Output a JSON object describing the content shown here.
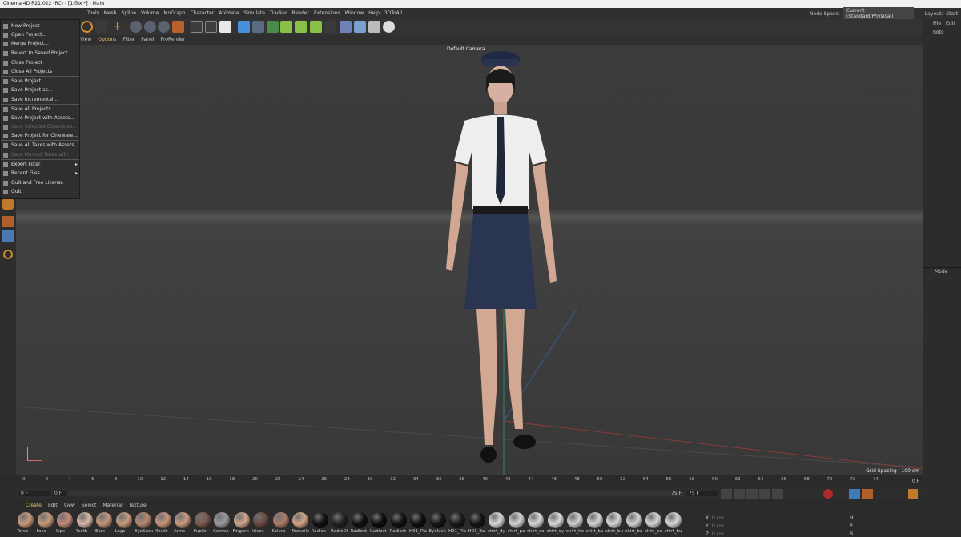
{
  "window": {
    "title": "Cinema 4D R21.022 (RC) - [1.fbx *] - Main"
  },
  "menubar": {
    "items": [
      "Tools",
      "Mesh",
      "Spline",
      "Volume",
      "MoGraph",
      "Character",
      "Animate",
      "Simulate",
      "Tracker",
      "Render",
      "Extensions",
      "Window",
      "Help",
      "3DToAll"
    ],
    "node_space_label": "Node Space:",
    "node_space_value": "Current (Standard/Physical)",
    "layout_label": "Layout:",
    "layout_value": "Start"
  },
  "right_tabs": {
    "file": "File",
    "edit": "Edit",
    "object": "Roto",
    "mode": "Mode"
  },
  "viewport_menu": [
    "View",
    "Options",
    "Filter",
    "Panel",
    "ProRender"
  ],
  "viewport": {
    "camera_label": "Default Camera",
    "grid_spacing": "Grid Spacing : 100 cm"
  },
  "file_menu": [
    {
      "label": "New Project",
      "disabled": false
    },
    {
      "label": "Open Project...",
      "disabled": false
    },
    {
      "label": "Merge Project...",
      "disabled": false
    },
    {
      "label": "Revert to Saved Project...",
      "disabled": false
    },
    {
      "sep": true
    },
    {
      "label": "Close Project",
      "disabled": false
    },
    {
      "label": "Close All Projects",
      "disabled": false
    },
    {
      "sep": true
    },
    {
      "label": "Save Project",
      "disabled": false
    },
    {
      "label": "Save Project as...",
      "disabled": false
    },
    {
      "label": "Save Incremental...",
      "disabled": false
    },
    {
      "sep": true
    },
    {
      "label": "Save All Projects",
      "disabled": false
    },
    {
      "label": "Save Project with Assets...",
      "disabled": false
    },
    {
      "label": "Save Selected Objects as...",
      "disabled": true
    },
    {
      "label": "Save Project for Cineware...",
      "disabled": false
    },
    {
      "sep": true
    },
    {
      "label": "Save All Takes with Assets",
      "disabled": false
    },
    {
      "label": "Save Marked Takes with Assets...",
      "disabled": true
    },
    {
      "sep": true
    },
    {
      "label": "Export Filter",
      "disabled": false,
      "submenu": true
    },
    {
      "label": "Recent Files",
      "disabled": false,
      "submenu": true
    },
    {
      "sep": true
    },
    {
      "label": "Quit and Free License",
      "disabled": false
    },
    {
      "label": "Quit",
      "disabled": false
    }
  ],
  "timeline": {
    "ticks": [
      "0",
      "2",
      "4",
      "6",
      "8",
      "10",
      "12",
      "14",
      "16",
      "18",
      "20",
      "22",
      "24",
      "26",
      "28",
      "30",
      "32",
      "34",
      "36",
      "38",
      "40",
      "42",
      "44",
      "46",
      "48",
      "50",
      "52",
      "54",
      "56",
      "58",
      "60",
      "62",
      "64",
      "66",
      "68",
      "70",
      "72",
      "74"
    ],
    "end": "0 F"
  },
  "frames": {
    "start": "0 F",
    "current": "0 F",
    "end": "75 F",
    "end2": "75 F"
  },
  "material_menu": [
    "Create",
    "Edit",
    "View",
    "Select",
    "Material",
    "Texture"
  ],
  "materials": [
    {
      "name": "Torso",
      "color": "#c89a7a"
    },
    {
      "name": "Face",
      "color": "#c99a7c"
    },
    {
      "name": "Lips",
      "color": "#c48a7a"
    },
    {
      "name": "Teeth",
      "color": "#d6b7a5"
    },
    {
      "name": "Ears",
      "color": "#c6957a"
    },
    {
      "name": "Legs",
      "color": "#c89b7d"
    },
    {
      "name": "EyeSock",
      "color": "#b88a70"
    },
    {
      "name": "Mouth",
      "color": "#c9947c"
    },
    {
      "name": "Arms",
      "color": "#c89c7e"
    },
    {
      "name": "Pupils",
      "color": "#7a5a4e"
    },
    {
      "name": "Cornea",
      "color": "#9a9a9a"
    },
    {
      "name": "Fingern",
      "color": "#d0a68c"
    },
    {
      "name": "Irises",
      "color": "#6a4a44"
    },
    {
      "name": "Sclera",
      "color": "#b07a6a"
    },
    {
      "name": "Toenails",
      "color": "#d2a488"
    },
    {
      "name": "Radios",
      "color": "#111111"
    },
    {
      "name": "RadioDi",
      "color": "#222222"
    },
    {
      "name": "Radiost",
      "color": "#111111"
    },
    {
      "name": "Radiost",
      "color": "#0d0d0d"
    },
    {
      "name": "Radiost",
      "color": "#111111"
    },
    {
      "name": "H01_Pla",
      "color": "#0f0f0f"
    },
    {
      "name": "Eyelash",
      "color": "#151515"
    },
    {
      "name": "H01_Pla",
      "color": "#1a1a1a"
    },
    {
      "name": "H01_Ba",
      "color": "#151515"
    },
    {
      "name": "shirt_dy",
      "color": "#d9d9d9"
    },
    {
      "name": "shirt_po",
      "color": "#d4d4d4"
    },
    {
      "name": "shirt_co",
      "color": "#d8d8d8"
    },
    {
      "name": "shirt_dy",
      "color": "#dadada"
    },
    {
      "name": "shirt_tie",
      "color": "#d0d0d0"
    },
    {
      "name": "shirt_bu",
      "color": "#d6d6d6"
    },
    {
      "name": "shirt_bu",
      "color": "#d8d8d8"
    },
    {
      "name": "shirt_bu",
      "color": "#d3d3d3"
    },
    {
      "name": "shirt_bu",
      "color": "#d6d6d6"
    },
    {
      "name": "shirt_bu",
      "color": "#d8d8d8"
    }
  ],
  "coords": {
    "x": "X",
    "y": "Y",
    "z": "Z",
    "h": "H",
    "p": "P",
    "b": "B",
    "xv": "0 cm",
    "yv": "0 cm",
    "zv": "0 cm"
  },
  "colors": {
    "accent": "#e6c15a",
    "select_blue": "#3d7bb6"
  }
}
